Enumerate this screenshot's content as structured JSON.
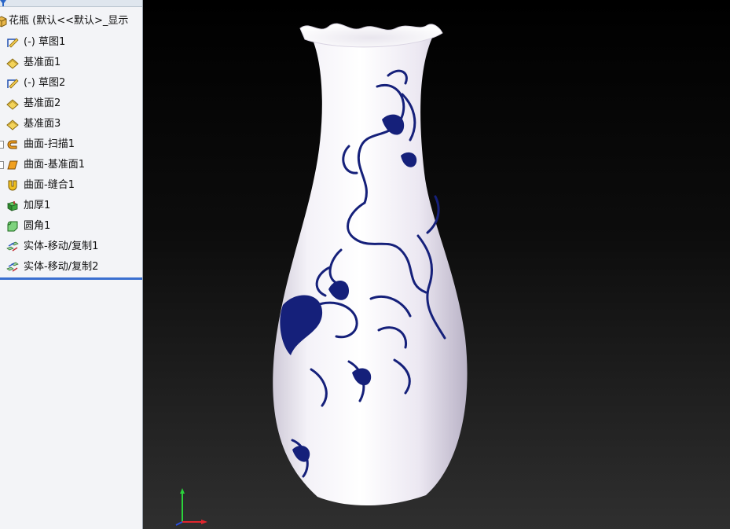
{
  "feature_tree": {
    "root": "花瓶 (默认<<默认>_显示",
    "items": [
      {
        "label": "(-) 草图1",
        "icon": "sketch-icon"
      },
      {
        "label": "基准面1",
        "icon": "plane-icon"
      },
      {
        "label": "(-) 草图2",
        "icon": "sketch-icon"
      },
      {
        "label": "基准面2",
        "icon": "plane-icon"
      },
      {
        "label": "基准面3",
        "icon": "plane-icon"
      },
      {
        "label": "曲面-扫描1",
        "icon": "surface-sweep-icon"
      },
      {
        "label": "曲面-基准面1",
        "icon": "surface-planar-icon"
      },
      {
        "label": "曲面-缝合1",
        "icon": "surface-knit-icon"
      },
      {
        "label": "加厚1",
        "icon": "thicken-icon"
      },
      {
        "label": "圆角1",
        "icon": "fillet-icon"
      },
      {
        "label": "实体-移动/复制1",
        "icon": "move-copy-icon"
      },
      {
        "label": "实体-移动/复制2",
        "icon": "move-copy-icon"
      }
    ]
  },
  "colors": {
    "pattern_blue": "#15207a",
    "rollback_blue": "#3a6fd0",
    "panel_bg": "#f3f4f7"
  }
}
